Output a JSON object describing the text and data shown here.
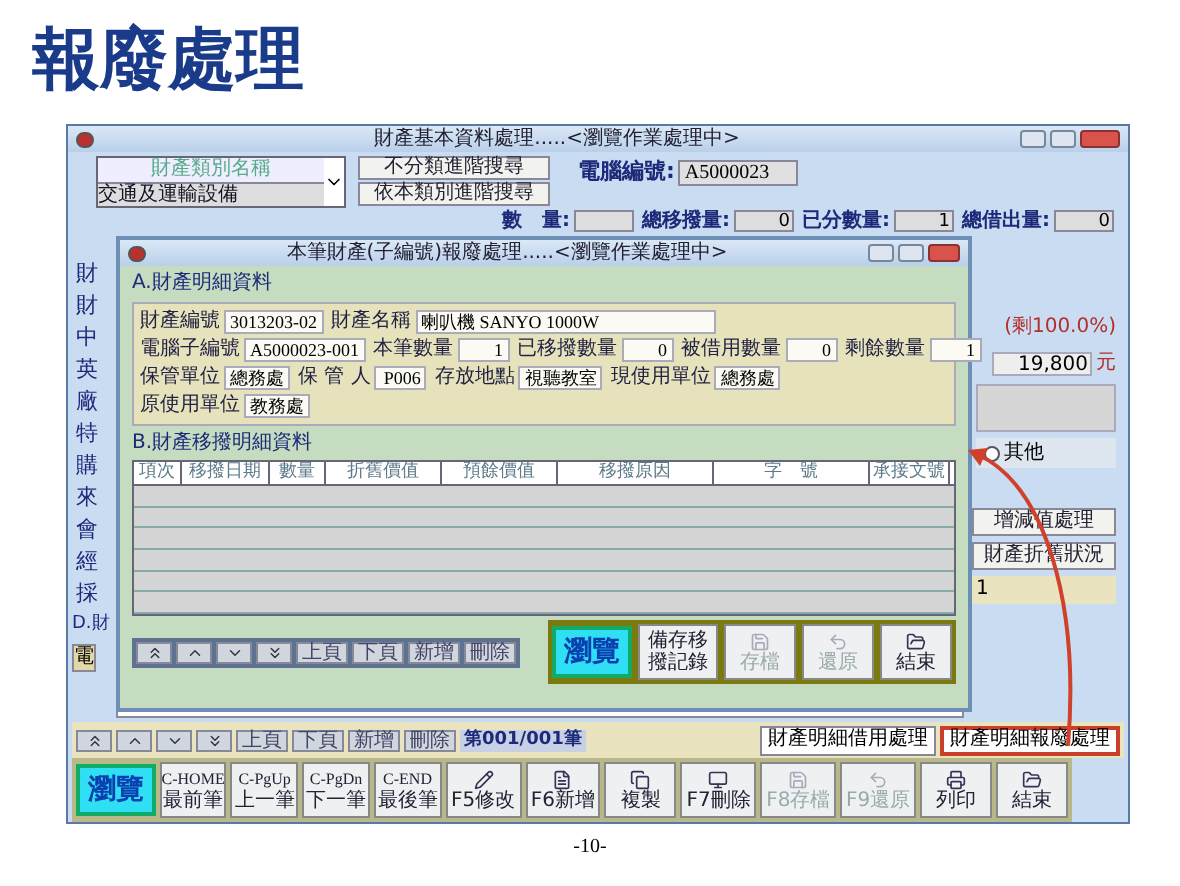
{
  "slide": {
    "title": "報廢處理",
    "page_number": "-10-"
  },
  "main_window": {
    "title": "財產基本資料處理.....<瀏覽作業處理中>",
    "category_combo": {
      "label": "財產類別名稱",
      "value": "交通及運輸設備"
    },
    "search_buttons": [
      "不分類進階搜尋",
      "依本類別進階搜尋"
    ],
    "computer_id": {
      "label": "電腦編號:",
      "value": "A5000023"
    },
    "quantity_fields": [
      {
        "label": "數　量:"
      },
      {
        "label": "總移撥量:",
        "value": "0"
      },
      {
        "label": "已分數量:",
        "value": "1"
      },
      {
        "label": "總借出量:",
        "value": "0"
      }
    ],
    "side_labels": [
      "財",
      "財",
      "中",
      "英",
      "廠",
      "特",
      "購",
      "來",
      "會",
      "經",
      "採"
    ],
    "section_label": "D.財",
    "grid_header": "電",
    "remaining": "(剩100.0%)",
    "amount": "19,800",
    "currency": "元",
    "radio": {
      "label": "其他",
      "selected": false
    },
    "side_buttons": [
      "增減值處理",
      "財產折舊狀況"
    ],
    "count": "1",
    "nav_buttons": [
      "上頁",
      "下頁",
      "新增",
      "刪除"
    ],
    "record_position": "第001/001筆",
    "detail_buttons": [
      {
        "label": "財產明細借用處理",
        "highlighted": false
      },
      {
        "label": "財產明細報廢處理",
        "highlighted": true
      }
    ],
    "toolbar": [
      {
        "kind": "mode",
        "label": "瀏覽",
        "active": true
      },
      {
        "kind": "key",
        "key": "C-HOME",
        "label": "最前筆"
      },
      {
        "kind": "key",
        "key": "C-PgUp",
        "label": "上一筆"
      },
      {
        "kind": "key",
        "key": "C-PgDn",
        "label": "下一筆"
      },
      {
        "kind": "key",
        "key": "C-END",
        "label": "最後筆"
      },
      {
        "kind": "icon",
        "label": "F5修改",
        "disabled": false
      },
      {
        "kind": "icon",
        "label": "F6新增",
        "disabled": false
      },
      {
        "kind": "icon",
        "label": "複製",
        "disabled": false
      },
      {
        "kind": "icon",
        "label": "F7刪除",
        "disabled": false
      },
      {
        "kind": "icon",
        "label": "F8存檔",
        "disabled": true
      },
      {
        "kind": "icon",
        "label": "F9還原",
        "disabled": true
      },
      {
        "kind": "icon",
        "label": "列印",
        "disabled": false
      },
      {
        "kind": "icon",
        "label": "結束",
        "disabled": false
      }
    ]
  },
  "inner_window": {
    "title": "本筆財產(子編號)報廢處理.....<瀏覽作業處理中>",
    "section_a": "A.財產明細資料",
    "field_rows": [
      [
        {
          "label": "財產編號",
          "value": "3013203-02"
        },
        {
          "label": "財產名稱",
          "value": "喇叭機 SANYO 1000W",
          "wide": true
        }
      ],
      [
        {
          "label": "電腦子編號",
          "value": "A5000023-001"
        },
        {
          "label": "本筆數量",
          "value": "1"
        },
        {
          "label": "已移撥數量",
          "value": "0"
        },
        {
          "label": "被借用數量",
          "value": "0"
        },
        {
          "label": "剩餘數量",
          "value": "1"
        }
      ],
      [
        {
          "label": "保管單位",
          "value": "總務處"
        },
        {
          "label": "保 管 人",
          "value": "P006"
        },
        {
          "label": "存放地點",
          "value": "視聽教室"
        },
        {
          "label": "現使用單位",
          "value": "總務處"
        }
      ],
      [
        {
          "label": "原使用單位",
          "value": "教務處"
        }
      ]
    ],
    "section_b": "B.財產移撥明細資料",
    "table": {
      "columns": [
        "項次",
        "移撥日期",
        "數量",
        "折舊價值",
        "預餘價值",
        "移撥原因",
        "字　號",
        "承接文號"
      ]
    },
    "nav_buttons": [
      "上頁",
      "下頁",
      "新增",
      "刪除"
    ],
    "buttons": [
      {
        "kind": "mode",
        "label": "瀏覽",
        "active": true,
        "disabled": false
      },
      {
        "kind": "text",
        "label": "備存移撥記錄",
        "disabled": false
      },
      {
        "kind": "icon",
        "label": "存檔",
        "disabled": true
      },
      {
        "kind": "icon",
        "label": "還原",
        "disabled": true
      },
      {
        "kind": "icon",
        "label": "結束",
        "disabled": false
      }
    ]
  }
}
